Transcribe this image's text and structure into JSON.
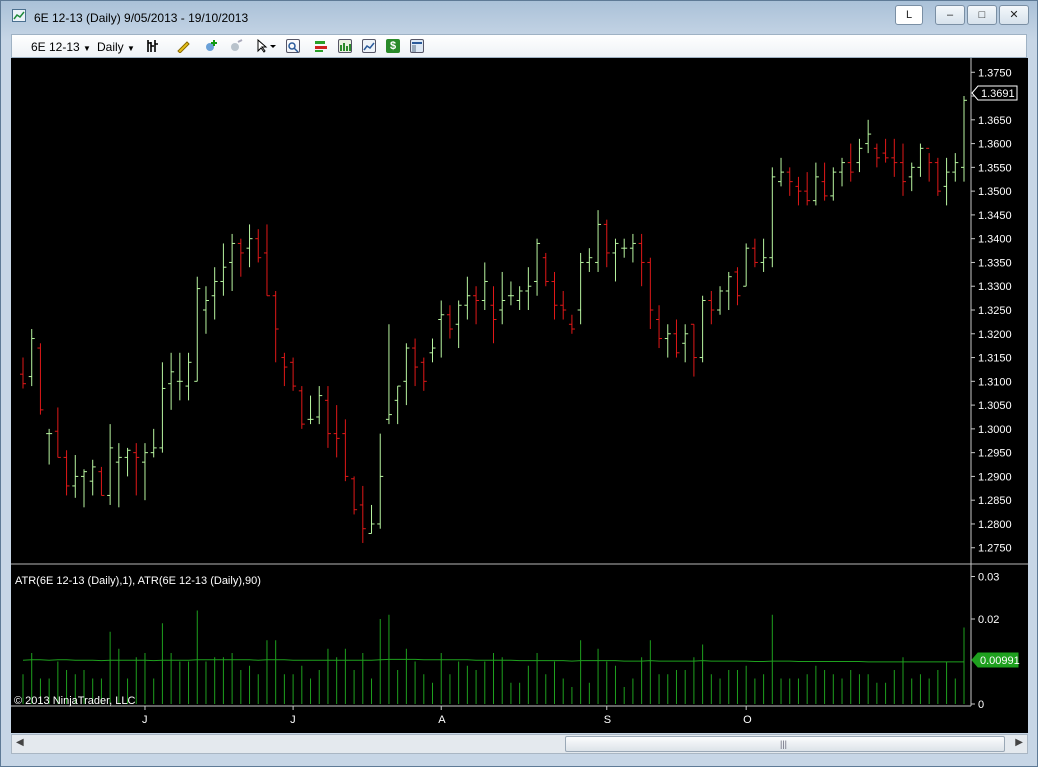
{
  "window": {
    "title": "6E 12-13 (Daily)  9/05/2013 - 19/10/2013",
    "btn_l": "L",
    "btn_min": "–",
    "btn_max": "□",
    "btn_close": "✕"
  },
  "toolbar": {
    "instrument": "6E 12-13",
    "period": "Daily",
    "icons": [
      "bar-type-icon",
      "pencil-draw-icon",
      "add-indicator-icon",
      "strategy-icon",
      "cursor-pointer-icon",
      "zoom-icon",
      "data-box-icon",
      "chart-style-icon",
      "line-chart-icon",
      "price-dollar-icon",
      "properties-icon"
    ]
  },
  "chart": {
    "current_price": "1.3691",
    "price_ticks": [
      "1.3750",
      "1.3700",
      "1.3650",
      "1.3600",
      "1.3550",
      "1.3500",
      "1.3450",
      "1.3400",
      "1.3350",
      "1.3300",
      "1.3250",
      "1.3200",
      "1.3150",
      "1.3100",
      "1.3050",
      "1.3000",
      "1.2950",
      "1.2900",
      "1.2850",
      "1.2800",
      "1.2750"
    ],
    "indicator_label": "ATR(6E 12-13 (Daily),1), ATR(6E 12-13 (Daily),90)",
    "indicator_ticks": [
      "0.03",
      "0.02",
      "0"
    ],
    "indicator_value": "0.00991",
    "x_labels": [
      "J",
      "J",
      "A",
      "S",
      "O"
    ],
    "copyright": "© 2013 NinjaTrader, LLC",
    "up_color": "#b8f5a0",
    "down_color": "#e01818",
    "atr_color": "#1ea01e"
  },
  "chart_data": {
    "type": "bar",
    "series": [
      {
        "values": [
          [
            1.3115,
            1.315,
            1.3085,
            1.3095
          ],
          [
            1.311,
            1.321,
            1.309,
            1.319
          ],
          [
            1.317,
            1.318,
            1.303,
            1.304
          ],
          [
            1.299,
            1.3,
            1.2925,
            1.299
          ],
          [
            1.2995,
            1.3045,
            1.294,
            1.294
          ],
          [
            1.294,
            1.2955,
            1.286,
            1.288
          ],
          [
            1.288,
            1.2945,
            1.2855,
            1.29
          ],
          [
            1.29,
            1.2915,
            1.2835,
            1.291
          ],
          [
            1.289,
            1.2935,
            1.286,
            1.292
          ],
          [
            1.291,
            1.292,
            1.286,
            1.286
          ],
          [
            1.286,
            1.301,
            1.284,
            1.296
          ],
          [
            1.293,
            1.297,
            1.2835,
            1.294
          ],
          [
            1.294,
            1.296,
            1.29,
            1.2955
          ],
          [
            1.295,
            1.297,
            1.286,
            1.294
          ],
          [
            1.293,
            1.297,
            1.285,
            1.295
          ],
          [
            1.295,
            1.3,
            1.294,
            1.296
          ],
          [
            1.296,
            1.314,
            1.295,
            1.3085
          ],
          [
            1.3095,
            1.316,
            1.304,
            1.312
          ],
          [
            1.31,
            1.316,
            1.306,
            1.31
          ],
          [
            1.309,
            1.316,
            1.306,
            1.314
          ],
          [
            1.31,
            1.332,
            1.31,
            1.3295
          ],
          [
            1.325,
            1.33,
            1.32,
            1.327
          ],
          [
            1.328,
            1.334,
            1.323,
            1.331
          ],
          [
            1.331,
            1.339,
            1.328,
            1.334
          ],
          [
            1.335,
            1.341,
            1.329,
            1.339
          ],
          [
            1.339,
            1.34,
            1.332,
            1.337
          ],
          [
            1.338,
            1.343,
            1.334,
            1.34
          ],
          [
            1.34,
            1.342,
            1.335,
            1.336
          ],
          [
            1.337,
            1.343,
            1.328,
            1.328
          ],
          [
            1.328,
            1.329,
            1.314,
            1.321
          ],
          [
            1.315,
            1.316,
            1.309,
            1.313
          ],
          [
            1.314,
            1.315,
            1.308,
            1.309
          ],
          [
            1.308,
            1.309,
            1.3,
            1.301
          ],
          [
            1.302,
            1.307,
            1.301,
            1.302
          ],
          [
            1.3025,
            1.309,
            1.301,
            1.307
          ],
          [
            1.306,
            1.309,
            1.296,
            1.299
          ],
          [
            1.299,
            1.305,
            1.294,
            1.298
          ],
          [
            1.299,
            1.302,
            1.289,
            1.29
          ],
          [
            1.2895,
            1.29,
            1.282,
            1.283
          ],
          [
            1.284,
            1.288,
            1.276,
            1.279
          ],
          [
            1.278,
            1.284,
            1.278,
            1.28
          ],
          [
            1.28,
            1.299,
            1.279,
            1.29
          ],
          [
            1.302,
            1.322,
            1.301,
            1.303
          ],
          [
            1.306,
            1.309,
            1.301,
            1.309
          ],
          [
            1.31,
            1.318,
            1.305,
            1.317
          ],
          [
            1.317,
            1.319,
            1.309,
            1.313
          ],
          [
            1.314,
            1.315,
            1.308,
            1.31
          ],
          [
            1.316,
            1.319,
            1.314,
            1.317
          ],
          [
            1.323,
            1.327,
            1.315,
            1.324
          ],
          [
            1.324,
            1.326,
            1.319,
            1.321
          ],
          [
            1.322,
            1.327,
            1.317,
            1.326
          ],
          [
            1.326,
            1.332,
            1.323,
            1.328
          ],
          [
            1.328,
            1.33,
            1.322,
            1.327
          ],
          [
            1.327,
            1.335,
            1.325,
            1.331
          ],
          [
            1.326,
            1.33,
            1.318,
            1.323
          ],
          [
            1.325,
            1.333,
            1.322,
            1.327
          ],
          [
            1.328,
            1.331,
            1.326,
            1.328
          ],
          [
            1.327,
            1.33,
            1.325,
            1.329
          ],
          [
            1.329,
            1.334,
            1.325,
            1.33
          ],
          [
            1.331,
            1.34,
            1.328,
            1.339
          ],
          [
            1.336,
            1.337,
            1.33,
            1.331
          ],
          [
            1.331,
            1.333,
            1.323,
            1.326
          ],
          [
            1.326,
            1.329,
            1.323,
            1.325
          ],
          [
            1.322,
            1.324,
            1.32,
            1.321
          ],
          [
            1.325,
            1.337,
            1.322,
            1.335
          ],
          [
            1.335,
            1.338,
            1.333,
            1.336
          ],
          [
            1.335,
            1.346,
            1.333,
            1.343
          ],
          [
            1.343,
            1.344,
            1.334,
            1.337
          ],
          [
            1.337,
            1.34,
            1.331,
            1.339
          ],
          [
            1.338,
            1.34,
            1.336,
            1.338
          ],
          [
            1.338,
            1.341,
            1.335,
            1.339
          ],
          [
            1.339,
            1.341,
            1.33,
            1.335
          ],
          [
            1.335,
            1.336,
            1.321,
            1.325
          ],
          [
            1.323,
            1.326,
            1.317,
            1.319
          ],
          [
            1.319,
            1.322,
            1.315,
            1.32
          ],
          [
            1.32,
            1.323,
            1.315,
            1.316
          ],
          [
            1.318,
            1.322,
            1.314,
            1.32
          ],
          [
            1.322,
            1.322,
            1.311,
            1.315
          ],
          [
            1.315,
            1.328,
            1.314,
            1.327
          ],
          [
            1.327,
            1.329,
            1.322,
            1.325
          ],
          [
            1.325,
            1.33,
            1.324,
            1.329
          ],
          [
            1.329,
            1.333,
            1.325,
            1.332
          ],
          [
            1.333,
            1.334,
            1.326,
            1.328
          ],
          [
            1.33,
            1.339,
            1.33,
            1.338
          ],
          [
            1.338,
            1.34,
            1.334,
            1.335
          ],
          [
            1.335,
            1.34,
            1.333,
            1.336
          ],
          [
            1.336,
            1.355,
            1.334,
            1.353
          ],
          [
            1.352,
            1.357,
            1.351,
            1.354
          ],
          [
            1.354,
            1.355,
            1.349,
            1.352
          ],
          [
            1.351,
            1.353,
            1.347,
            1.35
          ],
          [
            1.35,
            1.354,
            1.347,
            1.348
          ],
          [
            1.348,
            1.356,
            1.347,
            1.353
          ],
          [
            1.352,
            1.356,
            1.348,
            1.349
          ],
          [
            1.349,
            1.355,
            1.348,
            1.354
          ],
          [
            1.354,
            1.357,
            1.351,
            1.356
          ],
          [
            1.356,
            1.36,
            1.352,
            1.354
          ],
          [
            1.356,
            1.361,
            1.354,
            1.359
          ],
          [
            1.36,
            1.365,
            1.358,
            1.362
          ],
          [
            1.359,
            1.36,
            1.355,
            1.357
          ],
          [
            1.358,
            1.361,
            1.356,
            1.357
          ],
          [
            1.357,
            1.361,
            1.353,
            1.356
          ],
          [
            1.356,
            1.36,
            1.349,
            1.352
          ],
          [
            1.353,
            1.356,
            1.35,
            1.355
          ],
          [
            1.355,
            1.36,
            1.353,
            1.359
          ],
          [
            1.359,
            1.358,
            1.352,
            1.356
          ],
          [
            1.356,
            1.357,
            1.349,
            1.35
          ],
          [
            1.351,
            1.357,
            1.347,
            1.354
          ],
          [
            1.354,
            1.358,
            1.352,
            1.356
          ],
          [
            1.355,
            1.37,
            1.352,
            1.3691
          ]
        ]
      },
      {
        "name": "",
        "values": [
          0.007,
          0.012,
          0.006,
          0.006,
          0.01,
          0.008,
          0.007,
          0.008,
          0.006,
          0.006,
          0.017,
          0.013,
          0.006,
          0.011,
          0.012,
          0.006,
          0.019,
          0.012,
          0.01,
          0.01,
          0.022,
          0.01,
          0.011,
          0.011,
          0.012,
          0.008,
          0.009,
          0.007,
          0.015,
          0.015,
          0.007,
          0.007,
          0.009,
          0.006,
          0.008,
          0.013,
          0.011,
          0.013,
          0.008,
          0.012,
          0.006,
          0.02,
          0.021,
          0.008,
          0.013,
          0.01,
          0.007,
          0.005,
          0.012,
          0.007,
          0.01,
          0.009,
          0.008,
          0.01,
          0.012,
          0.011,
          0.005,
          0.005,
          0.009,
          0.012,
          0.007,
          0.01,
          0.006,
          0.004,
          0.015,
          0.005,
          0.013,
          0.01,
          0.009,
          0.004,
          0.006,
          0.011,
          0.015,
          0.007,
          0.007,
          0.008,
          0.008,
          0.011,
          0.014,
          0.007,
          0.006,
          0.008,
          0.008,
          0.009,
          0.006,
          0.007,
          0.021,
          0.006,
          0.006,
          0.006,
          0.007,
          0.009,
          0.008,
          0.007,
          0.006,
          0.008,
          0.007,
          0.007,
          0.005,
          0.005,
          0.008,
          0.011,
          0.006,
          0.007,
          0.006,
          0.008,
          0.01,
          0.006,
          0.018
        ]
      },
      {
        "name": "",
        "values": [
          0.0103,
          0.0104,
          0.0104,
          0.0103,
          0.0104,
          0.0104,
          0.0103,
          0.0103,
          0.0103,
          0.0102,
          0.0103,
          0.0103,
          0.0103,
          0.0103,
          0.0103,
          0.0102,
          0.0103,
          0.0103,
          0.0103,
          0.0103,
          0.0104,
          0.0104,
          0.0104,
          0.0104,
          0.0104,
          0.0104,
          0.0104,
          0.0103,
          0.0104,
          0.0104,
          0.0104,
          0.0103,
          0.0103,
          0.0103,
          0.0103,
          0.0103,
          0.0103,
          0.0103,
          0.0103,
          0.0103,
          0.0103,
          0.0104,
          0.0105,
          0.0105,
          0.0105,
          0.0105,
          0.0104,
          0.0104,
          0.0104,
          0.0104,
          0.0104,
          0.0104,
          0.0103,
          0.0103,
          0.0103,
          0.0103,
          0.0103,
          0.0102,
          0.0102,
          0.0102,
          0.0102,
          0.0102,
          0.0102,
          0.0101,
          0.0102,
          0.0102,
          0.0102,
          0.0102,
          0.0102,
          0.0101,
          0.0101,
          0.0101,
          0.0102,
          0.0101,
          0.0101,
          0.0101,
          0.0101,
          0.0101,
          0.0102,
          0.0101,
          0.0101,
          0.0101,
          0.0101,
          0.0101,
          0.01,
          0.01,
          0.0101,
          0.0101,
          0.0101,
          0.01,
          0.01,
          0.01,
          0.01,
          0.01,
          0.01,
          0.01,
          0.01,
          0.0099,
          0.0099,
          0.0099,
          0.0099,
          0.0099,
          0.0099,
          0.0099,
          0.0099,
          0.0099,
          0.0099,
          0.0099,
          0.00991
        ]
      }
    ],
    "price_ylim": [
      1.272,
      1.378
    ],
    "indicator_ylim": [
      0,
      0.032
    ],
    "x_tick_bar_index": [
      14,
      31,
      48,
      67,
      83
    ],
    "grid": false
  }
}
